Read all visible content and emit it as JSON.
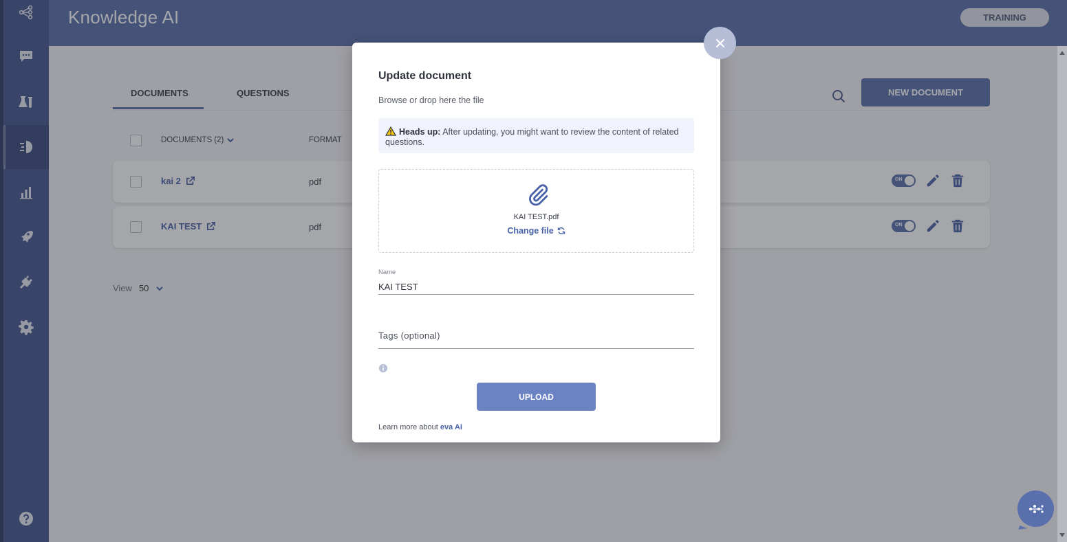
{
  "app": {
    "title": "Knowledge AI",
    "training_label": "TRAINING"
  },
  "sidebar": {
    "items": [
      {
        "icon": "flow-icon"
      },
      {
        "icon": "chat-icon"
      },
      {
        "icon": "lab-icon"
      },
      {
        "icon": "knowledge-icon",
        "active": true
      },
      {
        "icon": "chart-icon"
      },
      {
        "icon": "rocket-icon"
      },
      {
        "icon": "plug-icon"
      },
      {
        "icon": "gear-icon"
      },
      {
        "icon": "help-icon"
      }
    ]
  },
  "tabs": [
    {
      "label": "DOCUMENTS",
      "active": true
    },
    {
      "label": "QUESTIONS",
      "active": false
    }
  ],
  "toolbar": {
    "new_document_label": "NEW DOCUMENT"
  },
  "list": {
    "header_documents": "DOCUMENTS (2)",
    "header_format": "FORMAT",
    "rows": [
      {
        "name": "kai 2",
        "format": "pdf",
        "toggle": "ON"
      },
      {
        "name": "KAI TEST",
        "format": "pdf",
        "toggle": "ON"
      }
    ]
  },
  "pagination": {
    "view_label": "View",
    "view_value": "50"
  },
  "modal": {
    "title": "Update document",
    "subtitle": "Browse or drop here the file",
    "alert_strong": "Heads up:",
    "alert_text": " After updating, you might want to review the content of related questions.",
    "file_name": "KAI TEST.pdf",
    "change_file_label": "Change file",
    "name_label": "Name",
    "name_value": "KAI TEST",
    "tags_placeholder": "Tags (optional)",
    "upload_label": "UPLOAD",
    "learn_more_text": "Learn more about ",
    "learn_more_link": "eva AI"
  },
  "colors": {
    "sidebar": "#46598f",
    "header": "#5a70ad",
    "accent": "#4a62a8",
    "upload_button": "#6b82c3"
  }
}
